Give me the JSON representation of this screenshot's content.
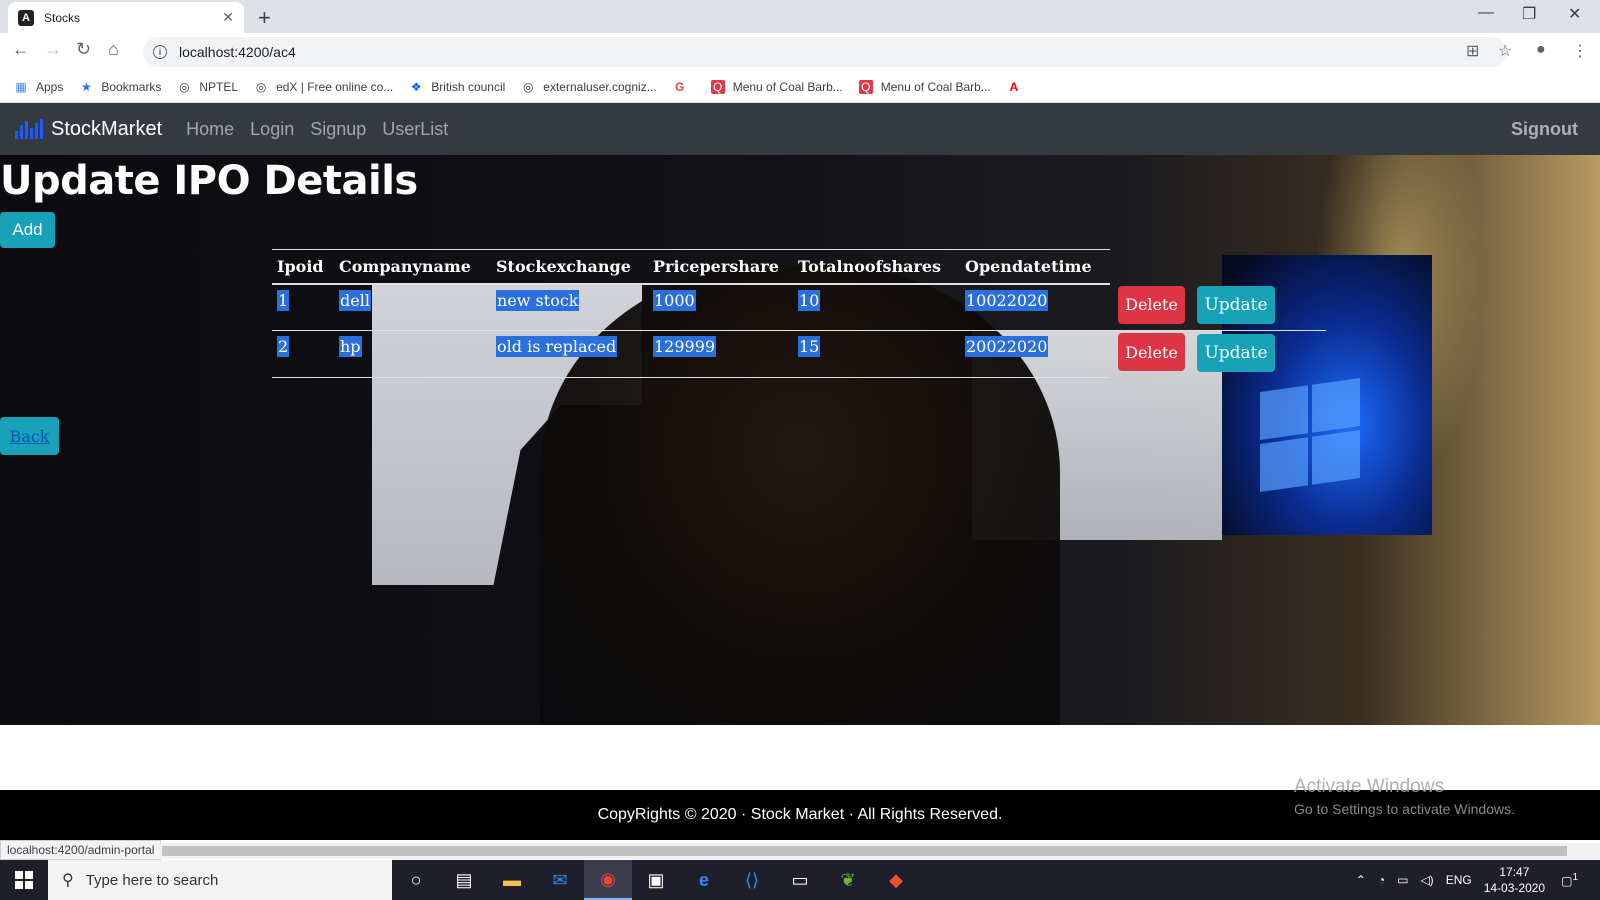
{
  "browser": {
    "tab_title": "Stocks",
    "tab_close": "✕",
    "new_tab": "+",
    "url": "localhost:4200/ac4",
    "status_url": "localhost:4200/admin-portal"
  },
  "bookmarks": [
    {
      "label": "Apps",
      "icon": "apps-grid-icon"
    },
    {
      "label": "Bookmarks",
      "icon": "star-icon"
    },
    {
      "label": "NPTEL",
      "icon": "globe-icon"
    },
    {
      "label": "edX | Free online co...",
      "icon": "globe-icon"
    },
    {
      "label": "British council",
      "icon": "dropbox-icon"
    },
    {
      "label": "externaluser.cogniz...",
      "icon": "globe-icon"
    },
    {
      "label": "",
      "icon": "google-icon"
    },
    {
      "label": "Menu of Coal Barb...",
      "icon": "zomato-icon"
    },
    {
      "label": "Menu of Coal Barb...",
      "icon": "zomato-icon"
    },
    {
      "label": "",
      "icon": "adobe-icon"
    }
  ],
  "navbar": {
    "brand": "StockMarket",
    "links": [
      "Home",
      "Login",
      "Signup",
      "UserList"
    ],
    "signout": "Signout"
  },
  "page": {
    "title": "Update IPO Details",
    "add_label": "Add",
    "back_label": "Back"
  },
  "table": {
    "headers": [
      "Ipoid",
      "Companyname",
      "Stockexchange",
      "Pricepershare",
      "Totalnoofshares",
      "Opendatetime"
    ],
    "rows": [
      [
        "1",
        "dell",
        "new stock",
        "1000",
        "10",
        "10022020"
      ],
      [
        "2",
        "hp",
        "old is replaced",
        "129999",
        "15",
        "20022020"
      ]
    ],
    "delete_label": "Delete",
    "update_label": "Update"
  },
  "footer": {
    "text": "CopyRights © 2020 · Stock Market · All Rights Reserved."
  },
  "watermark": {
    "line1": "Activate Windows",
    "line2": "Go to Settings to activate Windows."
  },
  "taskbar": {
    "search_placeholder": "Type here to search",
    "lang": "ENG",
    "time": "17:47",
    "date": "14-03-2020",
    "notifications": "1"
  },
  "colors": {
    "navbar": "#343a40",
    "info": "#17a2b8",
    "danger": "#dc3545",
    "selection": "#2a6fdb"
  }
}
